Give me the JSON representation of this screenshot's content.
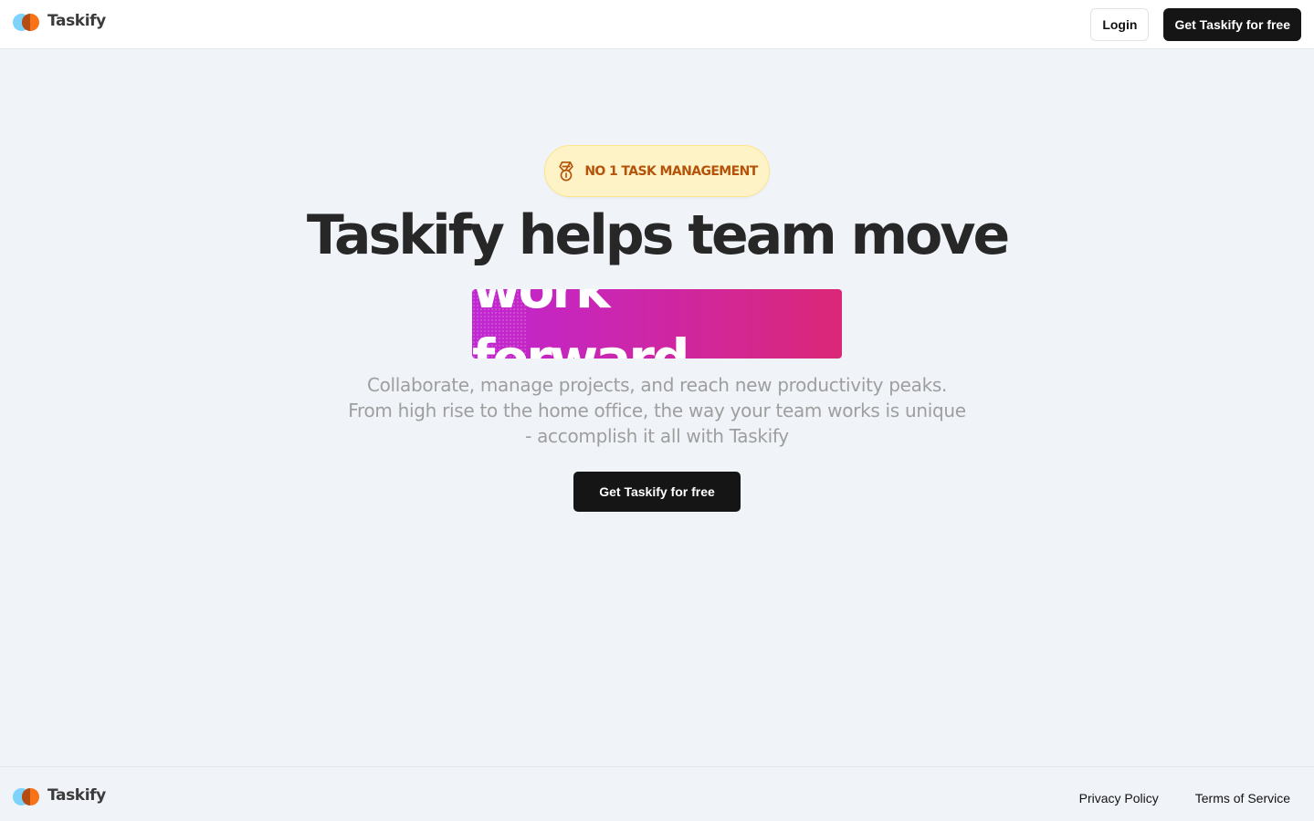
{
  "header": {
    "logo_text": "Taskify",
    "login_label": "Login",
    "cta_label": "Get Taskify for free"
  },
  "hero": {
    "badge_icon": "medal-icon",
    "badge_text": "No 1 task management",
    "headline": "Taskify helps team move",
    "highlight": "work forward.",
    "subtitle": "Collaborate, manage projects, and reach new productivity peaks. From high rise to the home office, the way your team works is unique - accomplish it all with Taskify",
    "cta_label": "Get Taskify for free"
  },
  "footer": {
    "logo_text": "Taskify",
    "links": [
      "Privacy Policy",
      "Terms of Service"
    ]
  },
  "colors": {
    "accent_gradient_start": "#c026d3",
    "accent_gradient_end": "#db2777",
    "badge_bg": "#fef3c7",
    "badge_text": "#b45309",
    "button_dark": "#151515",
    "page_bg": "#f0f3f8"
  }
}
